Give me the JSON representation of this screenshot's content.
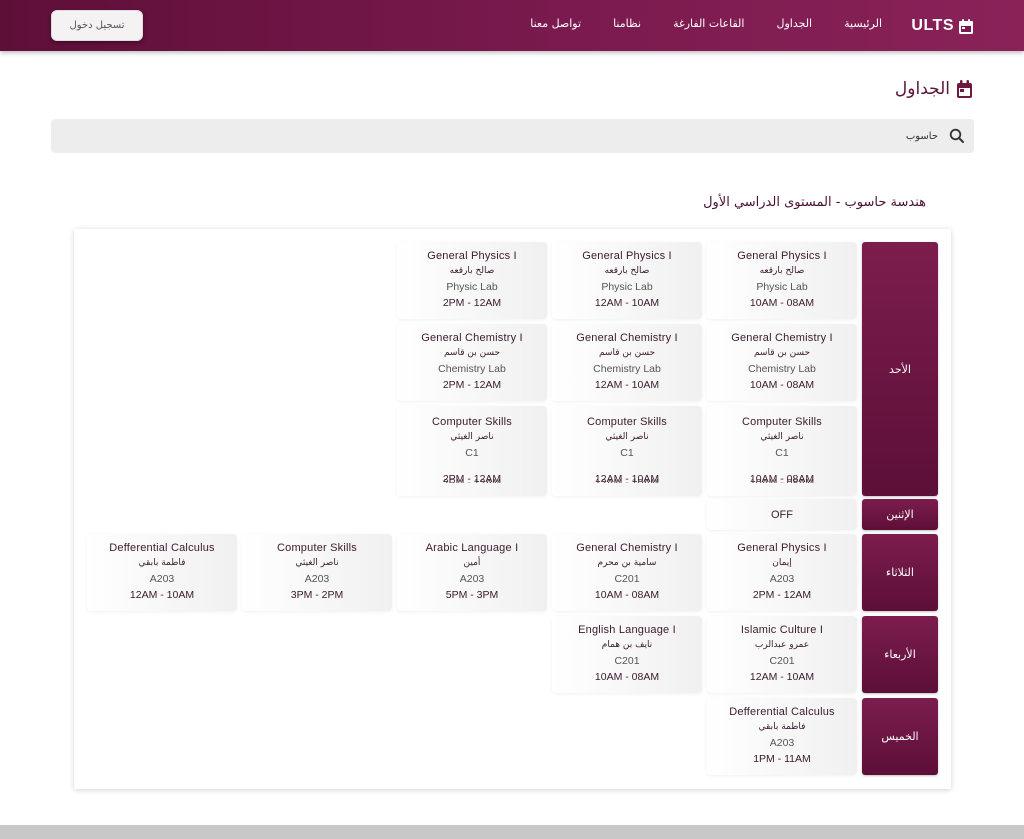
{
  "navbar": {
    "brand": "ULTS",
    "links": [
      "الرئيسية",
      "الجداول",
      "القاعات الفارغة",
      "نظامنا",
      "تواصل معنا"
    ],
    "login_label": "تسجيل دخول"
  },
  "page": {
    "title": "الجداول",
    "search_value": "حاسوب",
    "section_heading": "هندسة حاسوب - المستوى الدراسي الأول"
  },
  "schedule": {
    "sunday": {
      "label": "الأحد",
      "rows": [
        [
          {
            "course": "General Physics I",
            "teacher": "صالح بارقعه",
            "room": "Physic Lab",
            "time": "10AM - 08AM"
          },
          {
            "course": "General Physics I",
            "teacher": "صالح بارقعه",
            "room": "Physic Lab",
            "time": "12AM - 10AM"
          },
          {
            "course": "General Physics I",
            "teacher": "صالح بارقعه",
            "room": "Physic Lab",
            "time": "2PM - 12AM"
          }
        ],
        [
          {
            "course": "General Chemistry I",
            "teacher": "حسن بن قاسم",
            "room": "Chemistry Lab",
            "time": "10AM - 08AM"
          },
          {
            "course": "General Chemistry I",
            "teacher": "حسن بن قاسم",
            "room": "Chemistry Lab",
            "time": "12AM - 10AM"
          },
          {
            "course": "General Chemistry I",
            "teacher": "حسن بن قاسم",
            "room": "Chemistry Lab",
            "time": "2PM - 12AM"
          }
        ],
        [
          {
            "course": "Computer Skills",
            "teacher": "ناصر الغيثي",
            "room": "C1",
            "time": "10AM - 08AM"
          },
          {
            "course": "Computer Skills",
            "teacher": "ناصر الغيثي",
            "room": "C1",
            "time": "12AM - 10AM"
          },
          {
            "course": "Computer Skills",
            "teacher": "ناصر الغيثي",
            "room": "C1",
            "time": "2PM - 12AM"
          }
        ]
      ]
    },
    "monday": {
      "label": "الإثنين",
      "off_label": "OFF"
    },
    "tuesday": {
      "label": "الثلاثاء",
      "cards": [
        {
          "course": "General Physics I",
          "teacher": "إيمان",
          "room": "A203",
          "time": "2PM - 12AM"
        },
        {
          "course": "General Chemistry I",
          "teacher": "سامية بن محرم",
          "room": "C201",
          "time": "10AM - 08AM"
        },
        {
          "course": "Arabic Language I",
          "teacher": "أمين",
          "room": "A203",
          "time": "5PM - 3PM"
        },
        {
          "course": "Computer Skills",
          "teacher": "ناصر الغيثي",
          "room": "A203",
          "time": "3PM - 2PM"
        },
        {
          "course": "Defferential Calculus",
          "teacher": "فاطمة بابقي",
          "room": "A203",
          "time": "12AM - 10AM"
        }
      ]
    },
    "wednesday": {
      "label": "الأربعاء",
      "cards": [
        {
          "course": "Islamic Culture I",
          "teacher": "عمرو عبدالرب",
          "room": "C201",
          "time": "12AM - 10AM"
        },
        {
          "course": "English Language I",
          "teacher": "نايف بن همام",
          "room": "C201",
          "time": "10AM - 08AM"
        }
      ]
    },
    "thursday": {
      "label": "الخميس",
      "cards": [
        {
          "course": "Defferential Calculus",
          "teacher": "فاطمة بابقي",
          "room": "A203",
          "time": "1PM - 11AM"
        }
      ]
    }
  },
  "icons": {
    "brand": "calendar-icon",
    "title": "calendar-icon",
    "search": "search-icon"
  },
  "colors": {
    "primary": "#6e1743",
    "navbar_start": "#5e0f38",
    "navbar_end": "#8a2258",
    "search_bg": "#ededed"
  }
}
